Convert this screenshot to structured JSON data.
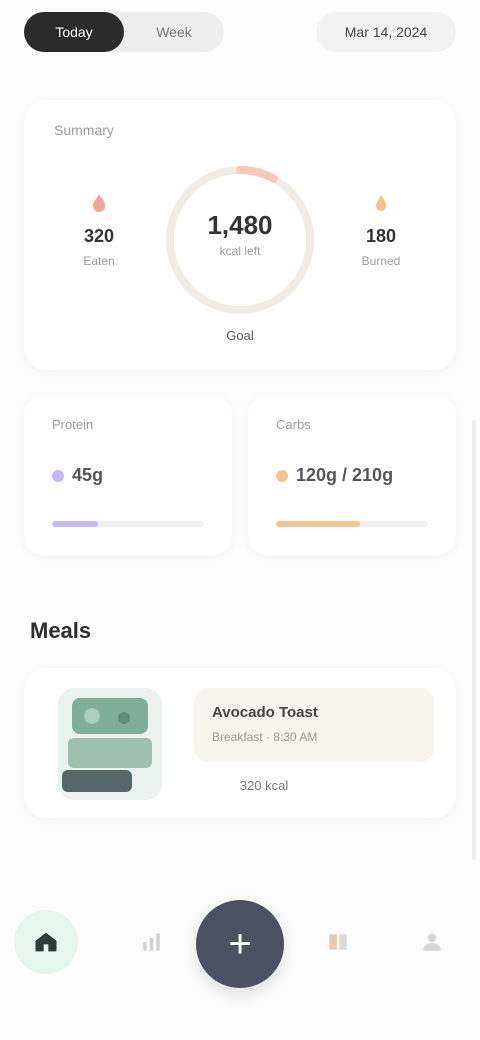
{
  "top_bar": {
    "tabs": [
      {
        "label": "Today",
        "active": true
      },
      {
        "label": "Week",
        "active": false
      }
    ],
    "action_label": "Mar 14, 2024"
  },
  "summary": {
    "title": "Summary",
    "left_stat": {
      "icon": "flame-icon",
      "value": "320",
      "label": "Eaten"
    },
    "right_stat": {
      "icon": "burn-icon",
      "value": "180",
      "label": "Burned"
    },
    "ring": {
      "value": "1,480",
      "label": "kcal left",
      "progress": 0.08
    },
    "caption": "Goal",
    "colors": {
      "ring_track": "#f1ebe6",
      "ring_fill": "#f7c8b5",
      "left_icon": "#f2a59a",
      "right_icon": "#f6c08a"
    }
  },
  "macros": [
    {
      "title": "Protein",
      "value": "45g",
      "color": "#c6b8f5",
      "progress": 0.3
    },
    {
      "title": "Carbs",
      "value": "120g / 210g",
      "color": "#f4c48f",
      "progress": 0.55
    }
  ],
  "meals": {
    "section_title": "Meals",
    "items": [
      {
        "name": "Avocado Toast",
        "sub": "Breakfast · 8:30 AM",
        "kcal": "320 kcal"
      }
    ]
  },
  "nav": {
    "items": [
      {
        "name": "home",
        "icon": "home-icon"
      },
      {
        "name": "stats",
        "icon": "chart-icon"
      },
      {
        "name": "add",
        "icon": "plus-icon",
        "label": "+"
      },
      {
        "name": "recipes",
        "icon": "book-icon"
      },
      {
        "name": "profile",
        "icon": "user-icon"
      }
    ],
    "colors": {
      "home_bg": "#e6f6ee",
      "add_bg": "#4d5060"
    }
  }
}
